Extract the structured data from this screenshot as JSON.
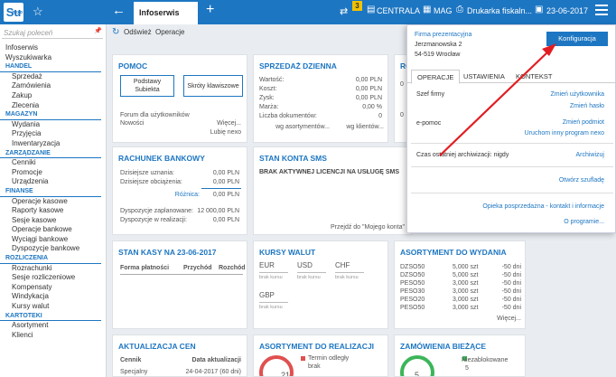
{
  "titlebar": {
    "logo": "Su",
    "logo_sup": "nexo",
    "active_tab": "Infoserwis",
    "badge": "3",
    "branch": "CENTRALA",
    "warehouse": "MAG",
    "printer": "Drukarka fiskaln...",
    "date": "23-06-2017"
  },
  "sidebar": {
    "search_placeholder": "Szukaj poleceń",
    "items": [
      {
        "label": "Infoserwis",
        "type": "top"
      },
      {
        "label": "Wyszukiwarka",
        "type": "top"
      },
      {
        "label": "HANDEL",
        "type": "sec"
      },
      {
        "label": "Sprzedaż",
        "type": "sub"
      },
      {
        "label": "Zamówienia",
        "type": "sub"
      },
      {
        "label": "Zakup",
        "type": "sub"
      },
      {
        "label": "Zlecenia",
        "type": "sub"
      },
      {
        "label": "MAGAZYN",
        "type": "sec"
      },
      {
        "label": "Wydania",
        "type": "sub"
      },
      {
        "label": "Przyjęcia",
        "type": "sub"
      },
      {
        "label": "Inwentaryzacja",
        "type": "sub"
      },
      {
        "label": "ZARZĄDZANIE",
        "type": "sec"
      },
      {
        "label": "Cenniki",
        "type": "sub"
      },
      {
        "label": "Promocje",
        "type": "sub"
      },
      {
        "label": "Urządzenia",
        "type": "sub"
      },
      {
        "label": "FINANSE",
        "type": "sec"
      },
      {
        "label": "Operacje kasowe",
        "type": "sub"
      },
      {
        "label": "Raporty kasowe",
        "type": "sub"
      },
      {
        "label": "Sesje kasowe",
        "type": "sub"
      },
      {
        "label": "Operacje bankowe",
        "type": "sub"
      },
      {
        "label": "Wyciągi bankowe",
        "type": "sub"
      },
      {
        "label": "Dyspozycje bankowe",
        "type": "sub"
      },
      {
        "label": "ROZLICZENIA",
        "type": "sec"
      },
      {
        "label": "Rozrachunki",
        "type": "sub"
      },
      {
        "label": "Sesje rozliczeniowe",
        "type": "sub"
      },
      {
        "label": "Kompensaty",
        "type": "sub"
      },
      {
        "label": "Windykacja",
        "type": "sub"
      },
      {
        "label": "Kursy walut",
        "type": "sub"
      },
      {
        "label": "KARTOTEKI",
        "type": "sec"
      },
      {
        "label": "Asortyment",
        "type": "sub"
      },
      {
        "label": "Klienci",
        "type": "sub"
      }
    ]
  },
  "toolbar": {
    "refresh": "Odśwież",
    "operations": "Operacje"
  },
  "pomoc": {
    "title": "POMOC",
    "btn1": "Podstawy Subiekta",
    "btn2": "Skróty klawiszowe",
    "forum": "Forum dla użytkowników",
    "news": "Nowości",
    "more": "Więcej...",
    "like": "Lubię nexo"
  },
  "sprzedaz": {
    "title": "SPRZEDAŻ DZIENNA",
    "rows": [
      {
        "label": "Wartość:",
        "value": "0,00 PLN"
      },
      {
        "label": "Koszt:",
        "value": "0,00 PLN"
      },
      {
        "label": "Zysk:",
        "value": "0,00 PLN"
      },
      {
        "label": "Marża:",
        "value": "0,00 %"
      },
      {
        "label": "Liczba dokumentów:",
        "value": "0"
      }
    ],
    "by_product": "wg asortymentów...",
    "by_client": "wg klientów..."
  },
  "ro": {
    "title": "RO"
  },
  "bank": {
    "title": "RACHUNEK BANKOWY",
    "credit_label": "Dzisiejsze uznania:",
    "credit": "0,00 PLN",
    "debit_label": "Dzisiejsze obciążenia:",
    "debit": "0,00 PLN",
    "diff_label": "Różnica:",
    "diff": "0,00 PLN",
    "planned_label": "Dyspozycje zaplanowane:",
    "planned": "12 000,00 PLN",
    "inprogress_label": "Dyspozycje w realizacji:",
    "inprogress": "0,00 PLN"
  },
  "sms": {
    "title": "STAN KONTA SMS",
    "msg": "BRAK AKTYWNEJ LICENCJI NA USŁUGĘ SMS",
    "link": "Przejdź do \"Mojego konta\""
  },
  "kasa": {
    "title": "STAN KASY NA 23-06-2017",
    "cols": [
      "Forma płatności",
      "Przychód",
      "Rozchód"
    ]
  },
  "kursy": {
    "title": "KURSY WALUT",
    "currencies": [
      "EUR",
      "USD",
      "CHF",
      "GBP"
    ],
    "no_rate": "brak kursu"
  },
  "asortyment": {
    "title": "ASORTYMENT DO WYDANIA",
    "rows": [
      {
        "code": "DZSO50",
        "qty": "5,000 szt",
        "days": "-50 dni"
      },
      {
        "code": "DZSO50",
        "qty": "5,000 szt",
        "days": "-50 dni"
      },
      {
        "code": "PESO50",
        "qty": "3,000 szt",
        "days": "-50 dni"
      },
      {
        "code": "PESO30",
        "qty": "3,000 szt",
        "days": "-50 dni"
      },
      {
        "code": "PESO20",
        "qty": "3,000 szt",
        "days": "-50 dni"
      },
      {
        "code": "PESO50",
        "qty": "3,000 szt",
        "days": "-50 dni"
      }
    ],
    "more": "Więcej..."
  },
  "aktualizacja": {
    "title": "AKTUALIZACJA CEN",
    "col1": "Cennik",
    "col2": "Data aktualizacji",
    "row1a": "Specjalny",
    "row1b": "24-04-2017 (60 dni)"
  },
  "realizacja": {
    "title": "ASORTYMENT DO REALIZACJI",
    "gauge": "21",
    "term": "Termin odległy",
    "brak": "brak"
  },
  "zamowienia": {
    "title": "ZAMÓWIENIA BIEŻĄCE",
    "gauge": "5",
    "unblocked": "Niezablokowane",
    "count": "5"
  },
  "popup": {
    "company": "Firma prezentacyjna",
    "street": "Jerzmanowska 2",
    "city": "54-519 Wrocław",
    "config": "Konfiguracja",
    "tabs": [
      "OPERACJE",
      "USTAWIENIA",
      "KONTEKST"
    ],
    "boss": "Szef firmy",
    "change_user": "Zmień użytkownika",
    "change_pass": "Zmień hasło",
    "epomoc": "e-pomoc",
    "change_entity": "Zmień podmiot",
    "run_other": "Uruchom inny program nexo",
    "archive_label": "Czas ostatniej archiwizacji: nigdy",
    "archive": "Archiwizuj",
    "open_drawer": "Otwórz szufladę",
    "care": "Opieka posprzedażna - kontakt i informacje",
    "about": "O programie..."
  },
  "colors": {
    "accent": "#1d76c2",
    "arrow": "#e11d22",
    "badge": "#f2c200",
    "gauge_red": "#e05050",
    "gauge_green": "#3cb55a"
  }
}
